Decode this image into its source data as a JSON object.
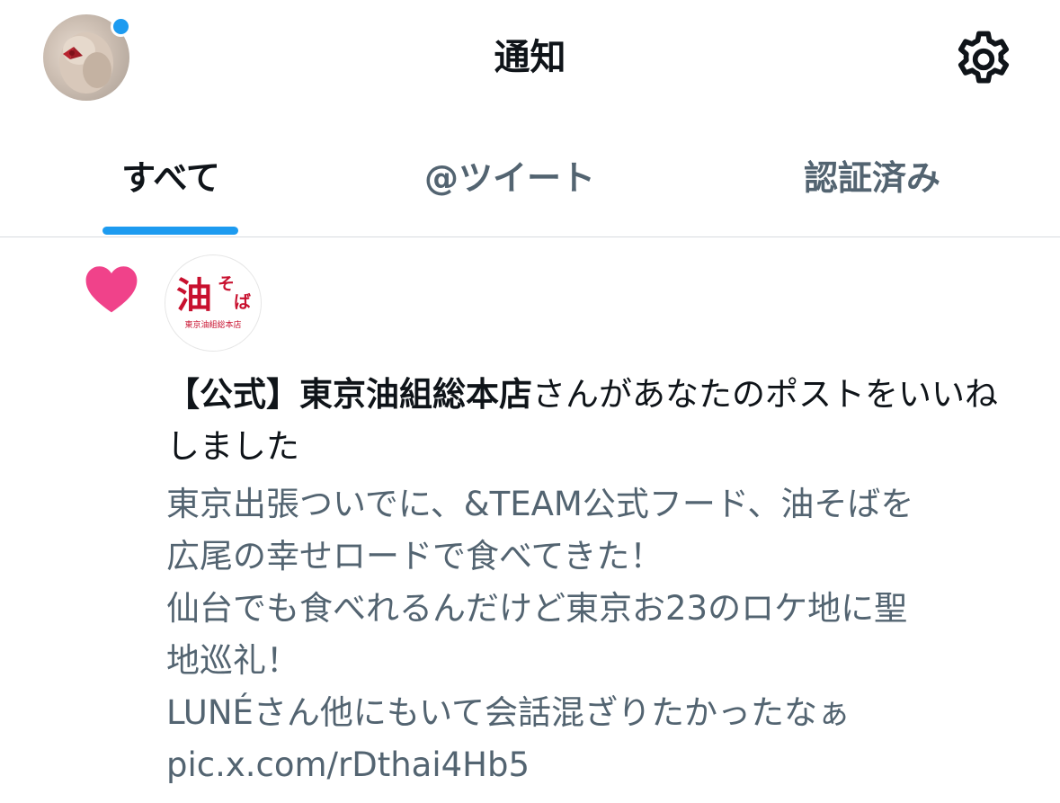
{
  "header": {
    "title": "通知",
    "settings_icon": "gear-icon",
    "avatar_icon": "profile-avatar",
    "avatar_badge_color": "#1d9bf0"
  },
  "tabs": [
    {
      "label": "すべて",
      "selected": true
    },
    {
      "label": "@ツイート",
      "selected": false
    },
    {
      "label": "認証済み",
      "selected": false
    }
  ],
  "accent_color": "#1d9bf0",
  "notification": {
    "type_icon": "heart-icon",
    "type_icon_color": "#f0428a",
    "avatar_logo": {
      "main_char": "油",
      "side_text": "そば",
      "bottom_text": "東京油組総本店",
      "color": "#c8102e"
    },
    "actor_name": "【公式】東京油組総本店",
    "action_text": "さんがあなたのポストをいいねしました",
    "tweet_lines": [
      "東京出張ついでに、&TEAM公式フード、油そばを",
      "広尾の幸せロードで食べてきた！",
      "仙台でも食べれるんだけど東京お23のロケ地に聖",
      "地巡礼！",
      "LUNÉさん他にもいて会話混ざりたかったなぁ",
      "pic.x.com/rDthai4Hb5"
    ]
  }
}
